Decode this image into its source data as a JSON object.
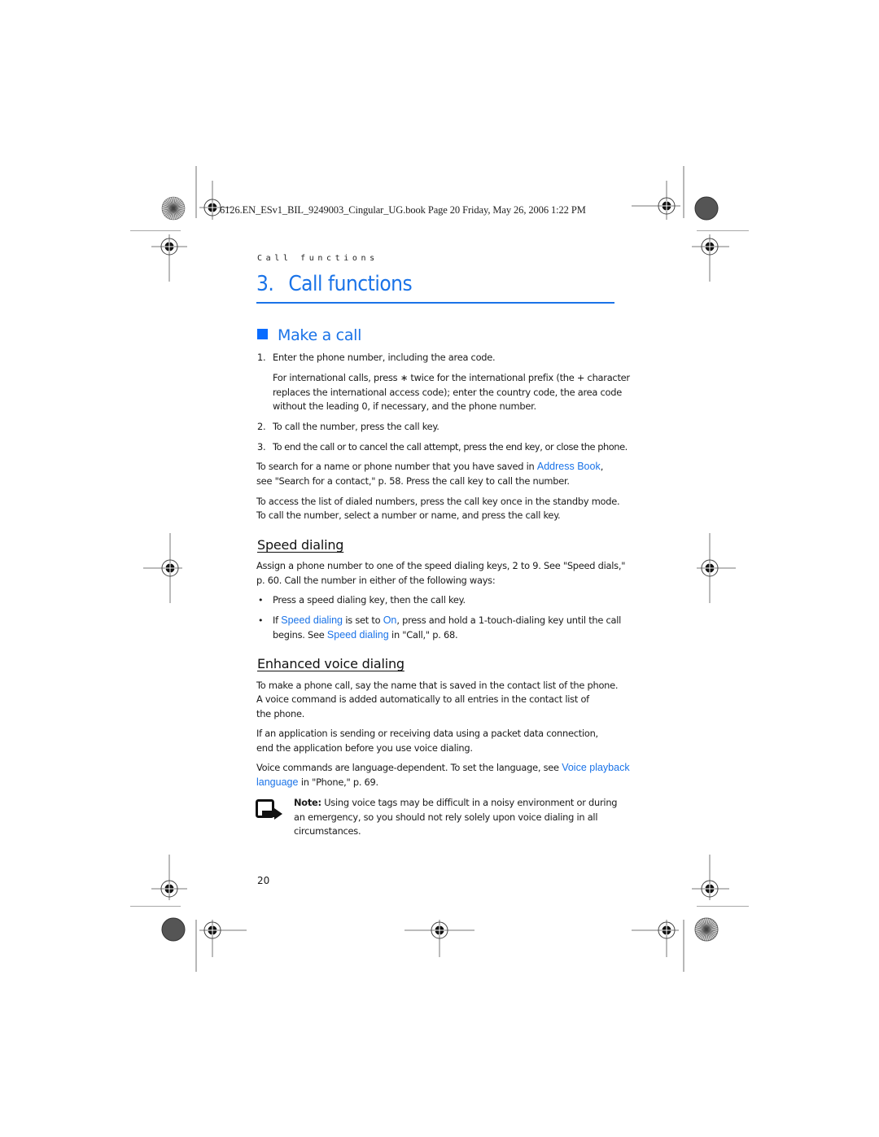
{
  "slug_line": "6126.EN_ESv1_BIL_9249003_Cingular_UG.book  Page 20  Friday, May 26, 2006  1:22 PM",
  "running_header": "Call functions",
  "chapter": {
    "number": "3.",
    "title": "Call functions"
  },
  "section": {
    "icon": "blue-square-icon",
    "title": "Make a call"
  },
  "make_call": {
    "steps": [
      {
        "num": "1.",
        "text": "Enter the phone number, including the area code."
      },
      {
        "num": "2.",
        "text": "To call the number, press the call key."
      },
      {
        "num": "3.",
        "text": "To end the call or to cancel the call attempt, press the end key, or close the phone."
      }
    ],
    "intl_note": [
      "For international calls, press ∗ twice for the international prefix (the + character",
      "replaces the international access code); enter the country code, the area code",
      "without the leading 0, if necessary, and the phone number."
    ],
    "search_para": {
      "pre": "To search for a name or phone number that you have saved in ",
      "link": "Address Book",
      "post": ",",
      "line2": "see \"Search for a contact,\" p. 58. Press the call key to call the number."
    },
    "dialed_para": [
      "To access the list of dialed numbers, press the call key once in the standby mode.",
      "To call the number, select a number or name, and press the call key."
    ]
  },
  "speed_dialing": {
    "title": "Speed dialing",
    "intro": [
      "Assign a phone number to one of the speed dialing keys, 2 to 9. See \"Speed dials,\"",
      "p. 60. Call the number in either of the following ways:"
    ],
    "bullet_symbol": "•",
    "bullet1": "Press a speed dialing key, then the call key.",
    "bullet2": {
      "pre": "If ",
      "link1": "Speed dialing",
      "mid1": " is set to ",
      "link2": "On",
      "mid2": ", press and hold a 1-touch-dialing key until the call",
      "line2_pre": "begins. See ",
      "link3": "Speed dialing",
      "line2_post": " in \"Call,\" p. 68."
    }
  },
  "voice_dialing": {
    "title": "Enhanced voice dialing",
    "para1": [
      "To make a phone call, say the name that is saved in the contact list of the phone.",
      "A voice command is added automatically to all entries in the contact list of",
      "the phone."
    ],
    "para2": [
      "If an application is sending or receiving data using a packet data connection,",
      "end the application before you use voice dialing."
    ],
    "para3": {
      "pre": "Voice commands are language-dependent. To set the language, see ",
      "link_line1": "Voice playback",
      "link_line2": "language",
      "post": " in \"Phone,\" p. 69."
    },
    "note": {
      "label": "Note:",
      "lines": [
        " Using voice tags may be difficult in a noisy environment or during",
        "an emergency, so you should not rely solely upon voice dialing in all",
        "circumstances."
      ]
    }
  },
  "page_number": "20",
  "colors": {
    "accent": "#1a73e8",
    "square": "#0a6cff",
    "text": "#1a1a1a"
  }
}
